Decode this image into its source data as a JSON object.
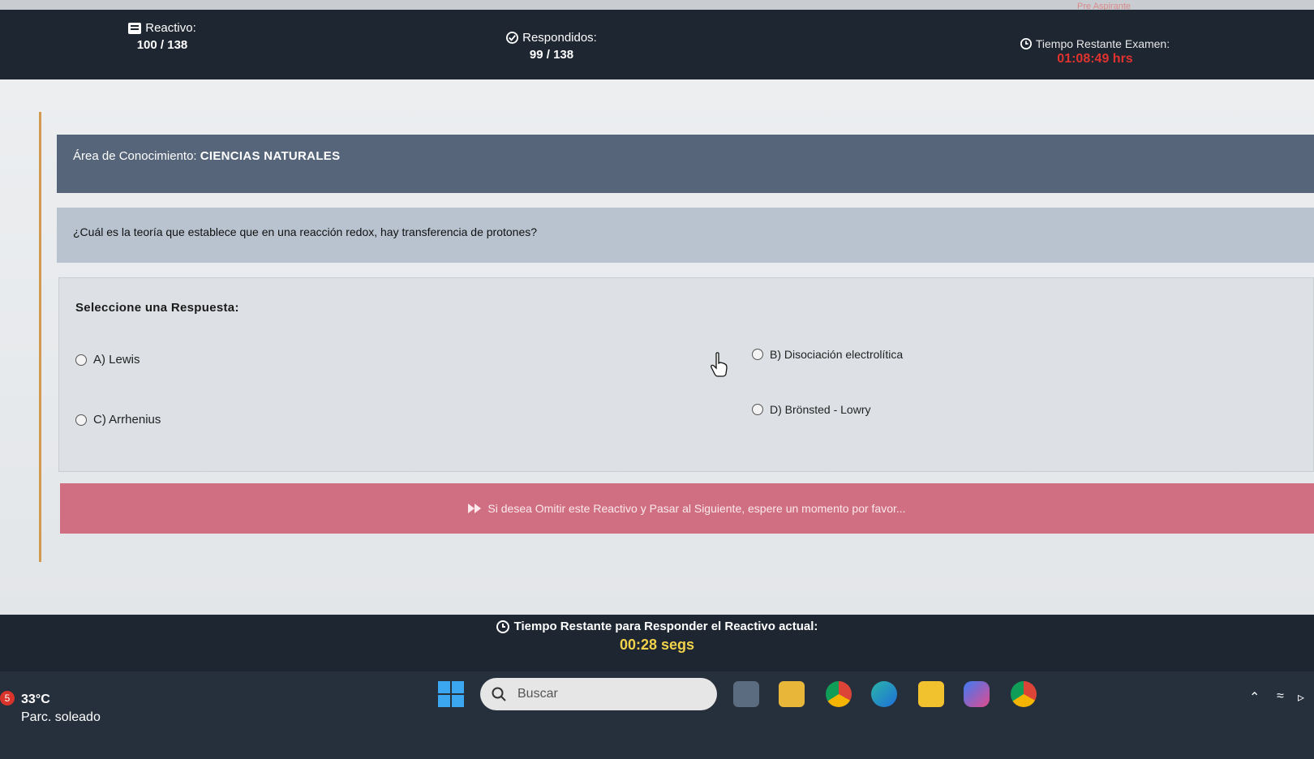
{
  "top_strip": {
    "pre_label": "Pre Aspirante"
  },
  "header": {
    "reactivo_label": "Reactivo:",
    "reactivo_value": "100 / 138",
    "respondidos_label": "Respondidos:",
    "respondidos_value": "99 / 138",
    "tiempo_label": "Tiempo Restante Examen:",
    "tiempo_value": "01:08:49 hrs"
  },
  "area": {
    "prefix": "Área de Conocimiento:",
    "name": "CIENCIAS NATURALES"
  },
  "question": {
    "text": "¿Cuál es la teoría que establece que en una reacción redox, hay transferencia de protones?"
  },
  "answers": {
    "title": "Seleccione una Respuesta:",
    "options": [
      {
        "label": "A) Lewis"
      },
      {
        "label": "B) Disociación electrolítica"
      },
      {
        "label": "C) Arrhenius"
      },
      {
        "label": "D) Brönsted - Lowry"
      }
    ]
  },
  "skip": {
    "text": "Si desea Omitir este Reactivo y Pasar al Siguiente, espere un momento por favor..."
  },
  "footer": {
    "label": "Tiempo Restante para Responder el Reactivo actual:",
    "value": "00:28 segs"
  },
  "taskbar": {
    "weather_badge": "5",
    "temperature": "33°C",
    "condition": "Parc. soleado",
    "search_placeholder": "Buscar"
  },
  "colors": {
    "header_bg": "#1d2631",
    "area_bg": "#56657a",
    "question_bg": "#b8c3cf",
    "skip_bg": "#d06f82",
    "timer_red": "#e0332f",
    "timer_yellow": "#f2d24a"
  }
}
